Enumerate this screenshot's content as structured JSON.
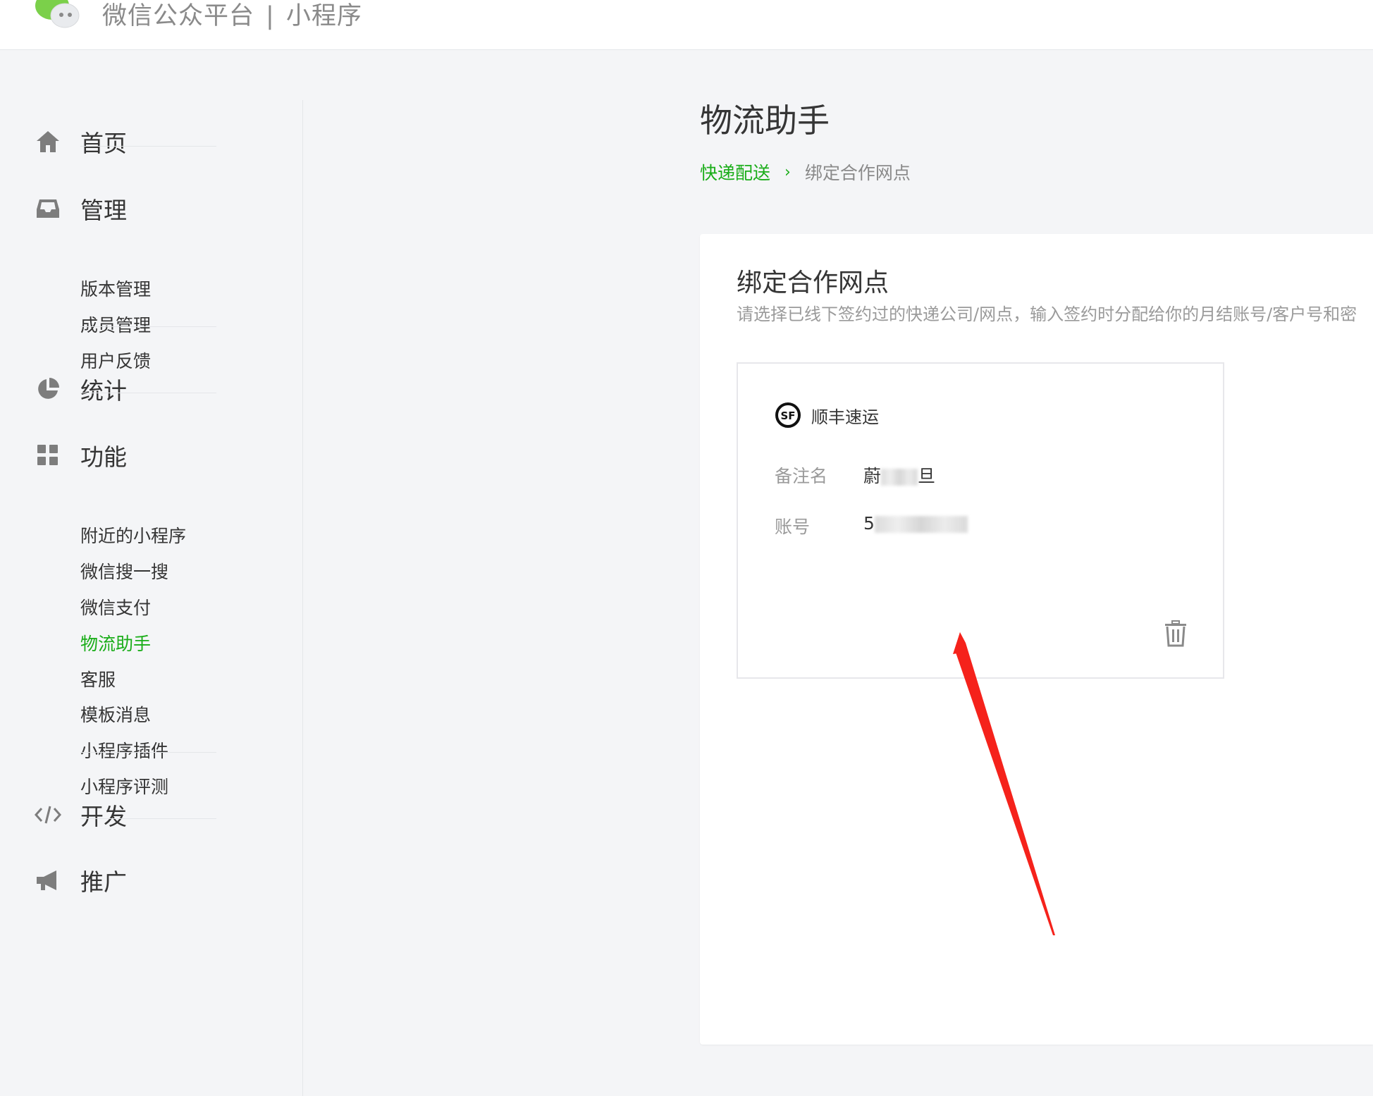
{
  "header": {
    "brand_primary": "微信公众平台",
    "brand_separator": "|",
    "brand_secondary": "小程序"
  },
  "sidebar": {
    "home": {
      "label": "首页",
      "icon": "home-icon"
    },
    "manage": {
      "label": "管理",
      "icon": "inbox-icon",
      "items": [
        "版本管理",
        "成员管理",
        "用户反馈"
      ]
    },
    "stats": {
      "label": "统计",
      "icon": "pie-chart-icon"
    },
    "features": {
      "label": "功能",
      "icon": "grid-icon",
      "items": [
        "附近的小程序",
        "微信搜一搜",
        "微信支付",
        "物流助手",
        "客服",
        "模板消息",
        "小程序插件",
        "小程序评测"
      ],
      "active_item": "物流助手"
    },
    "develop": {
      "label": "开发",
      "icon": "code-icon"
    },
    "promote": {
      "label": "推广",
      "icon": "megaphone-icon"
    }
  },
  "main": {
    "title": "物流助手",
    "breadcrumb": {
      "link": "快递配送",
      "separator": "›",
      "current": "绑定合作网点"
    },
    "panel": {
      "title": "绑定合作网点",
      "description": "请选择已线下签约过的快递公司/网点，输入签约时分配给你的月结账号/客户号和密"
    },
    "card": {
      "company_name": "顺丰速运",
      "logo_text": "SF",
      "remark_label": "备注名",
      "remark_value_prefix": "蔚",
      "remark_value_suffix": "旦",
      "account_label": "账号",
      "account_value_prefix": "5"
    }
  },
  "colors": {
    "accent_green": "#1aad19",
    "annotation_arrow": "#f5221b",
    "text_primary": "#353535",
    "text_secondary": "#9a9a9a"
  }
}
